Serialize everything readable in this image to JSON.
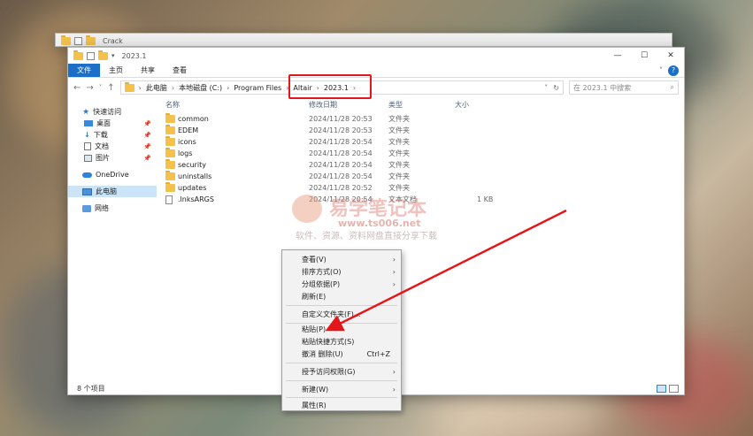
{
  "back_window": {
    "title": "Crack"
  },
  "window": {
    "title": "2023.1",
    "ribbon_tabs": [
      "文件",
      "主页",
      "共享",
      "查看"
    ],
    "window_controls": [
      "—",
      "☐",
      "✕"
    ],
    "help": "?",
    "collapse_chevron": "˅"
  },
  "address": {
    "crumbs": [
      "此电脑",
      "本地磁盘 (C:)",
      "Program Files",
      "Altair",
      "2023.1"
    ],
    "highlighted": [
      "Altair",
      "2023.1"
    ],
    "dropdown": "˅",
    "refresh": "↻"
  },
  "search": {
    "placeholder": "在 2023.1 中搜索",
    "icon": "search-icon"
  },
  "nav": {
    "back": "←",
    "forward": "→",
    "dropdown": "˅",
    "up": "↑"
  },
  "sidebar": {
    "quick_access": "快速访问",
    "quick_items": [
      {
        "label": "桌面",
        "pinned": true
      },
      {
        "label": "下载",
        "pinned": true
      },
      {
        "label": "文档",
        "pinned": true
      },
      {
        "label": "图片",
        "pinned": true
      }
    ],
    "onedrive": "OneDrive",
    "this_pc": "此电脑",
    "network": "网络"
  },
  "columns": {
    "name": "名称",
    "date": "修改日期",
    "type": "类型",
    "size": "大小"
  },
  "files": [
    {
      "name": "common",
      "date": "2024/11/28 20:53",
      "type": "文件夹",
      "size": "",
      "kind": "folder"
    },
    {
      "name": "EDEM",
      "date": "2024/11/28 20:53",
      "type": "文件夹",
      "size": "",
      "kind": "folder"
    },
    {
      "name": "icons",
      "date": "2024/11/28 20:54",
      "type": "文件夹",
      "size": "",
      "kind": "folder"
    },
    {
      "name": "logs",
      "date": "2024/11/28 20:54",
      "type": "文件夹",
      "size": "",
      "kind": "folder"
    },
    {
      "name": "security",
      "date": "2024/11/28 20:54",
      "type": "文件夹",
      "size": "",
      "kind": "folder"
    },
    {
      "name": "uninstalls",
      "date": "2024/11/28 20:54",
      "type": "文件夹",
      "size": "",
      "kind": "folder"
    },
    {
      "name": "updates",
      "date": "2024/11/28 20:52",
      "type": "文件夹",
      "size": "",
      "kind": "folder"
    },
    {
      "name": ".lnksARGS",
      "date": "2024/11/28 20:54",
      "type": "文本文档",
      "size": "1 KB",
      "kind": "file"
    }
  ],
  "status": {
    "item_count": "8 个项目"
  },
  "context_menu": {
    "items": [
      {
        "label": "查看(V)",
        "submenu": true
      },
      {
        "label": "排序方式(O)",
        "submenu": true
      },
      {
        "label": "分组依据(P)",
        "submenu": true
      },
      {
        "label": "刷新(E)"
      },
      {
        "label": "自定义文件夹(F)..."
      },
      {
        "label": "粘贴(P)",
        "highlighted_by_arrow": true
      },
      {
        "label": "粘贴快捷方式(S)"
      },
      {
        "label": "撤消 删除(U)",
        "shortcut": "Ctrl+Z"
      },
      {
        "label": "授予访问权限(G)",
        "submenu": true
      },
      {
        "label": "新建(W)",
        "submenu": true
      },
      {
        "label": "属性(R)"
      }
    ]
  },
  "watermark": {
    "title": "易学笔记本",
    "url": "www.ts006.net",
    "subtitle": "软件、资源、资料网盘直接分享下载"
  },
  "annotation_color": "#e3161b"
}
